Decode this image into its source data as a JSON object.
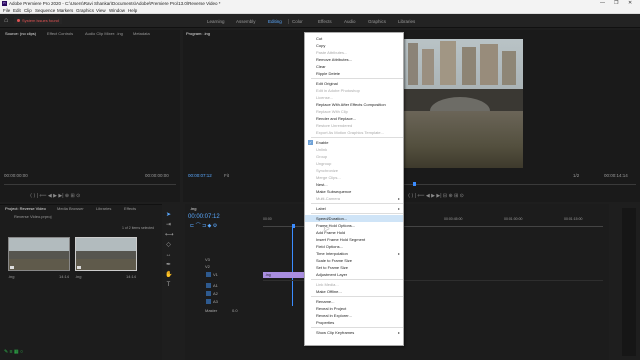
{
  "window": {
    "title": "Adobe Premiere Pro 2020 - C:\\Users\\Ravi Shankar\\Documents\\Adobe\\Premiere Pro\\13.0\\Reverse Video *",
    "app_icon": "Pr",
    "controls": [
      "—",
      "❐",
      "✕"
    ]
  },
  "menubar": [
    "File",
    "Edit",
    "Clip",
    "Sequence",
    "Markers",
    "Graphics",
    "View",
    "Window",
    "Help"
  ],
  "workbar": {
    "warning": "System issues found",
    "workspaces": [
      "Learning",
      "Assembly",
      "Editing",
      "Color",
      "Effects",
      "Audio",
      "Graphics",
      "Libraries"
    ],
    "active": "Editing"
  },
  "source_panel": {
    "tabs": [
      "Source: (no clips)",
      "Effect Controls",
      "Audio Clip Mixer: .ing",
      "Metadata"
    ],
    "tc_left": "00:00:00:00",
    "tc_right": "00:00:00:00"
  },
  "program_panel": {
    "title": "Program: .ing",
    "timecode": "00:00:07:12",
    "fit": "Fit",
    "zoom": "1/2",
    "duration": "00:00:14:14"
  },
  "project_panel": {
    "tabs": [
      "Project: Reverse Video",
      "Media Browser",
      "Libraries",
      "Effects"
    ],
    "file": "Reverse Video.prproj",
    "selection": "1 of 2 items selected",
    "items": [
      {
        "name": ".ing",
        "duration": "14:14"
      },
      {
        "name": ".ing",
        "duration": "14:14"
      }
    ]
  },
  "timeline": {
    "tab": ".ing",
    "timecode": "00:00:07:12",
    "ruler": [
      "00:00",
      "00:00:15:00",
      "00:00:30:00",
      "00:00:45:00",
      "00:01:00:00",
      "00:01:15:00"
    ],
    "tracks": [
      "V3",
      "V2",
      "V1",
      "A1",
      "A2",
      "A3",
      "Master"
    ],
    "master_value": "0.0",
    "clip_label": ".ing"
  },
  "context_menu": {
    "items": [
      {
        "label": "Cut",
        "enabled": true
      },
      {
        "label": "Copy",
        "enabled": true
      },
      {
        "label": "Paste Attributes...",
        "enabled": false
      },
      {
        "label": "Remove Attributes...",
        "enabled": true
      },
      {
        "label": "Clear",
        "enabled": true
      },
      {
        "label": "Ripple Delete",
        "enabled": true
      },
      {
        "sep": true
      },
      {
        "label": "Edit Original",
        "enabled": true
      },
      {
        "label": "Edit in Adobe Photoshop",
        "enabled": false
      },
      {
        "label": "License...",
        "enabled": false
      },
      {
        "label": "Replace With After Effects Composition",
        "enabled": true
      },
      {
        "label": "Replace With Clip",
        "enabled": false
      },
      {
        "label": "Render and Replace...",
        "enabled": true
      },
      {
        "label": "Restore Unrendered",
        "enabled": false
      },
      {
        "label": "Export As Motion Graphics Template...",
        "enabled": false
      },
      {
        "sep": true
      },
      {
        "label": "Enable",
        "enabled": true,
        "checked": true
      },
      {
        "label": "Unlink",
        "enabled": false
      },
      {
        "label": "Group",
        "enabled": false
      },
      {
        "label": "Ungroup",
        "enabled": false
      },
      {
        "label": "Synchronize",
        "enabled": false
      },
      {
        "label": "Merge Clips...",
        "enabled": false
      },
      {
        "label": "Nest...",
        "enabled": true
      },
      {
        "label": "Make Subsequence",
        "enabled": true
      },
      {
        "label": "Multi-Camera",
        "enabled": false,
        "submenu": true
      },
      {
        "sep": true
      },
      {
        "label": "Label",
        "enabled": true,
        "submenu": true
      },
      {
        "sep": true
      },
      {
        "label": "Speed/Duration...",
        "enabled": true,
        "highlight": true
      },
      {
        "label": "Frame Hold Options...",
        "enabled": true
      },
      {
        "label": "Add Frame Hold",
        "enabled": true
      },
      {
        "label": "Insert Frame Hold Segment",
        "enabled": true
      },
      {
        "label": "Field Options...",
        "enabled": true
      },
      {
        "label": "Time Interpolation",
        "enabled": true,
        "submenu": true
      },
      {
        "label": "Scale to Frame Size",
        "enabled": true
      },
      {
        "label": "Set to Frame Size",
        "enabled": true
      },
      {
        "label": "Adjustment Layer",
        "enabled": true
      },
      {
        "sep": true
      },
      {
        "label": "Link Media...",
        "enabled": false
      },
      {
        "label": "Make Offline...",
        "enabled": true
      },
      {
        "sep": true
      },
      {
        "label": "Rename...",
        "enabled": true
      },
      {
        "label": "Reveal in Project",
        "enabled": true
      },
      {
        "label": "Reveal in Explorer...",
        "enabled": true
      },
      {
        "label": "Properties",
        "enabled": true
      },
      {
        "sep": true
      },
      {
        "label": "Show Clip Keyframes",
        "enabled": true,
        "submenu": true
      }
    ]
  }
}
